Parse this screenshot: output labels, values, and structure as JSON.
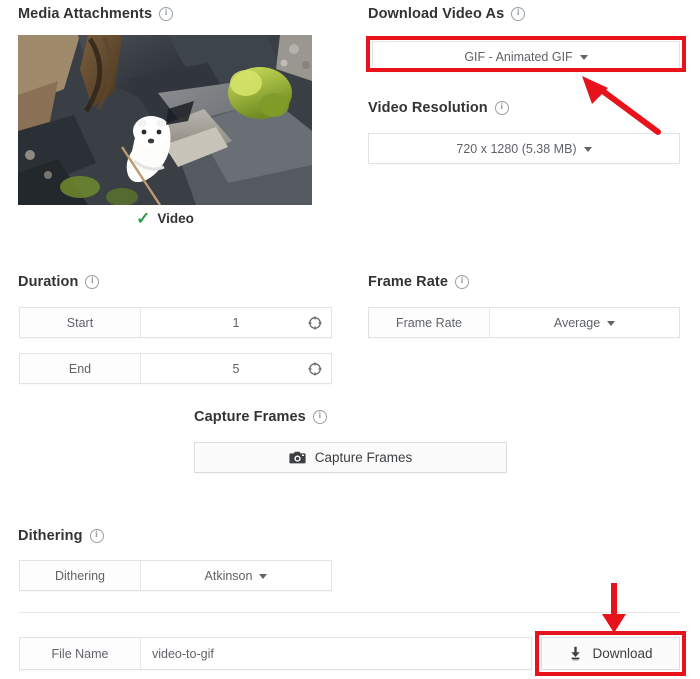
{
  "sections": {
    "media_attachments": {
      "title": "Media Attachments",
      "info": "info-icon",
      "thumbnail_alt": "video-thumbnail",
      "status_label": "Video",
      "status_check": "✓"
    },
    "download_video_as": {
      "title": "Download Video As",
      "selected": "GIF - Animated GIF"
    },
    "video_resolution": {
      "title": "Video Resolution",
      "selected": "720 x 1280 (5.38 MB)"
    },
    "duration": {
      "title": "Duration",
      "rows": [
        {
          "label": "Start",
          "value": "1"
        },
        {
          "label": "End",
          "value": "5"
        }
      ]
    },
    "frame_rate": {
      "title": "Frame Rate",
      "row": {
        "label": "Frame Rate",
        "value": "Average"
      }
    },
    "capture_frames": {
      "title": "Capture Frames",
      "button_label": "Capture Frames",
      "button_icon": "camera-icon"
    },
    "dithering": {
      "title": "Dithering",
      "row": {
        "label": "Dithering",
        "value": "Atkinson"
      }
    },
    "file_name": {
      "label": "File Name",
      "value": "video-to-gif",
      "placeholder": "video-to-gif"
    },
    "download": {
      "button_label": "Download",
      "button_icon": "download-icon"
    }
  },
  "annotations": {
    "highlight_color": "#e8131a",
    "highlighted_targets": [
      "GIF - Animated GIF",
      "Download"
    ],
    "arrow_count": 2
  },
  "colors": {
    "accent_red": "#e8131a",
    "check_green": "#2e9e4f",
    "text_primary": "#333333",
    "text_secondary": "#5f6368",
    "border": "#e2e3e5"
  }
}
